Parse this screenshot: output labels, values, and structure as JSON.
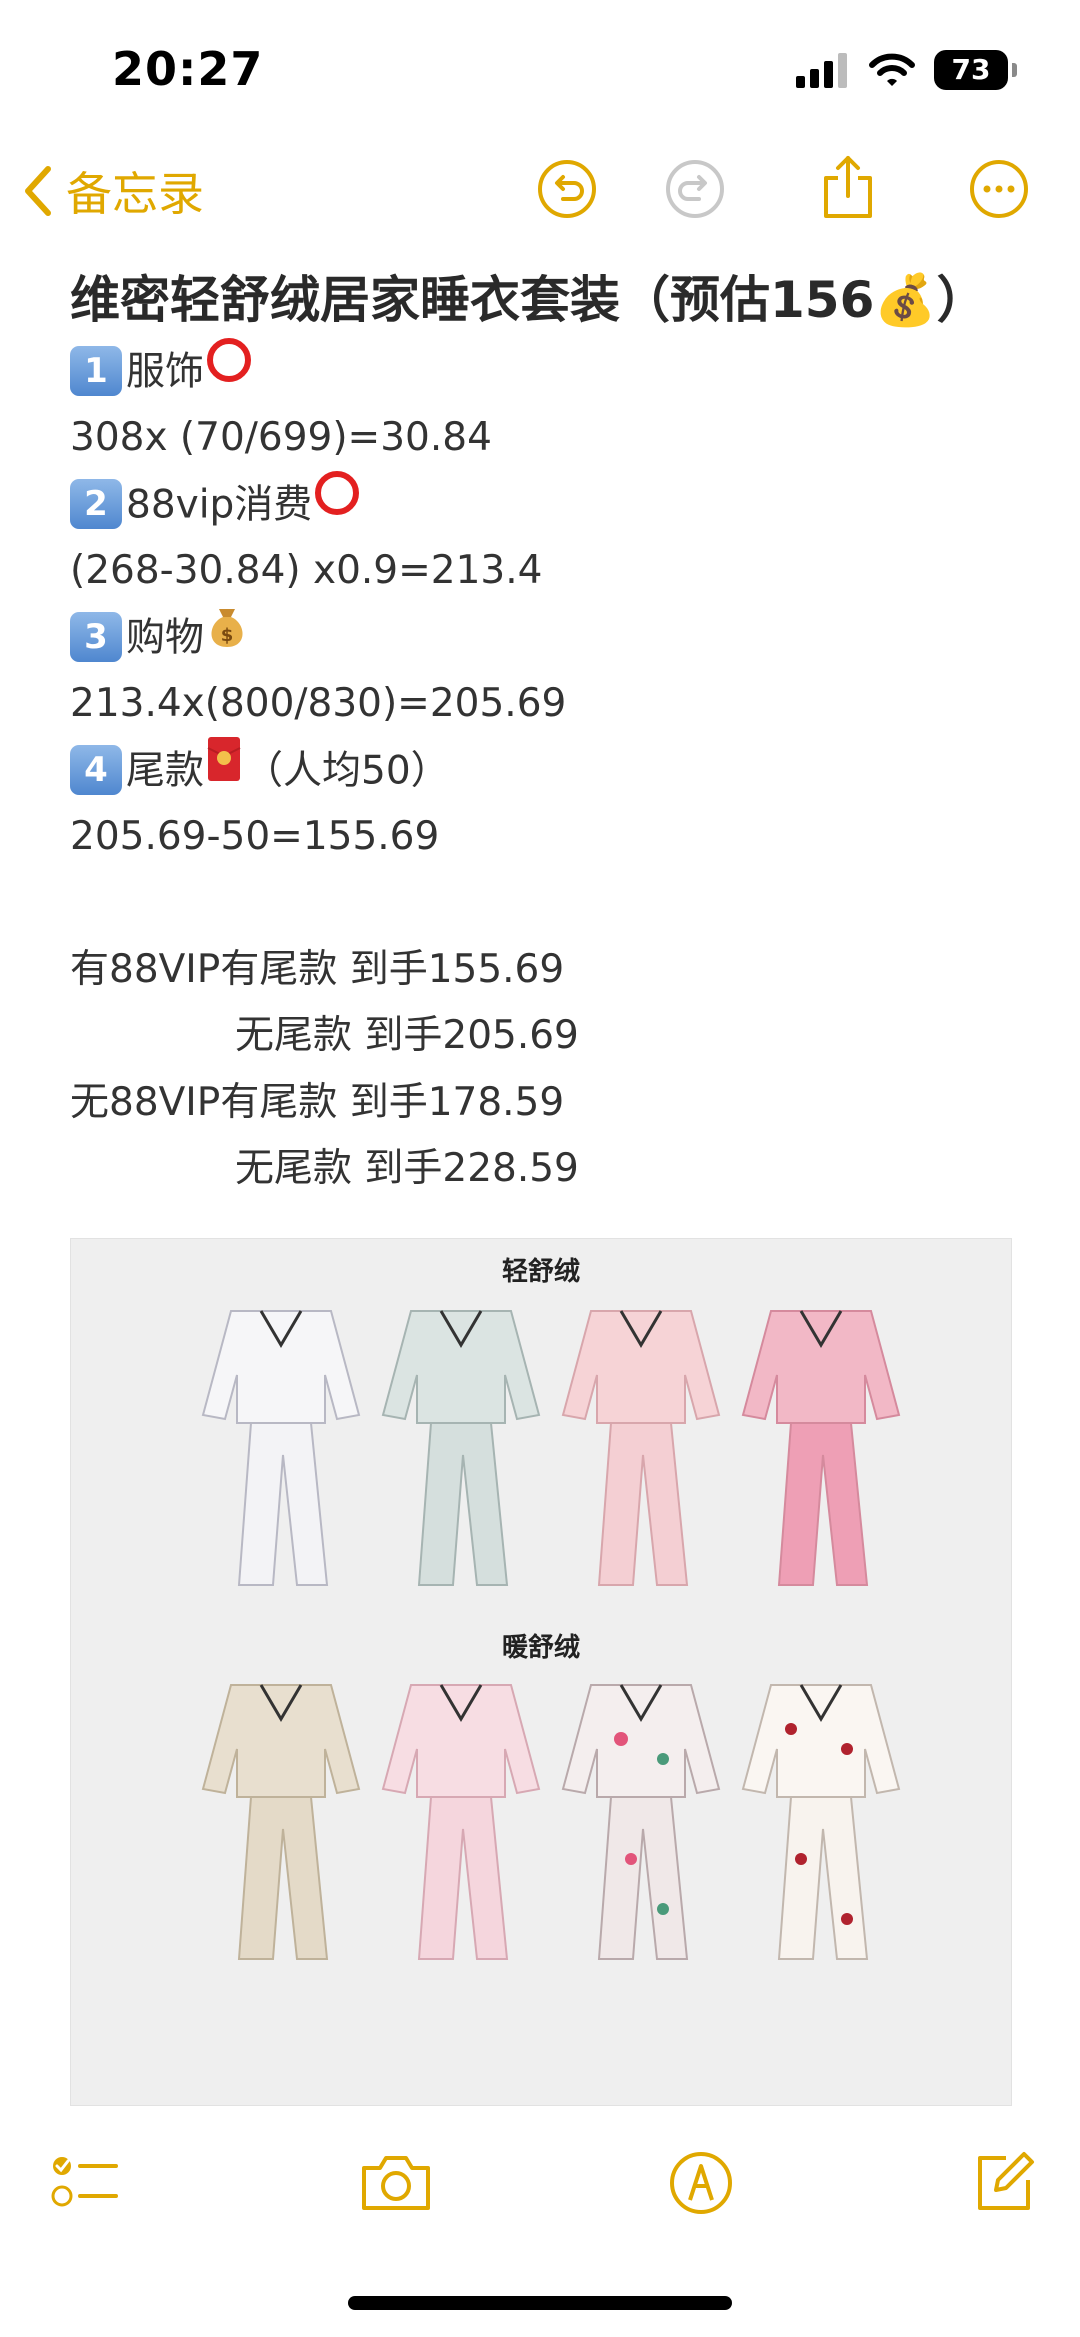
{
  "status": {
    "time": "20:27",
    "battery": "73"
  },
  "nav": {
    "back_label": "备忘录"
  },
  "note": {
    "title": "维密轻舒绒居家睡衣套装（预估156💰）",
    "lines": {
      "l1_label": "服饰",
      "l1_formula": "308x (70/699)=30.84",
      "l2_label": "88vip消费",
      "l2_formula": "(268-30.84) x0.9=213.4",
      "l3_label": "购物",
      "l3_formula": "213.4x(800/830)=205.69",
      "l4_label": "尾款",
      "l4_suffix": "（人均50）",
      "l4_formula": "205.69-50=155.69",
      "s1": "有88VIP有尾款 到手155.69",
      "s2": "无尾款 到手205.69",
      "s3": "无88VIP有尾款 到手178.59",
      "s4": "无尾款 到手228.59"
    },
    "numbers": {
      "n1": "1",
      "n2": "2",
      "n3": "3",
      "n4": "4"
    }
  },
  "image": {
    "section1": "轻舒绒",
    "section2": "暖舒绒"
  },
  "colors": {
    "accent": "#e0a800",
    "accent_gray": "#c8c8c8"
  },
  "icons": [
    "chevron-left-icon",
    "undo-icon",
    "redo-icon",
    "share-icon",
    "more-icon",
    "checklist-icon",
    "camera-icon",
    "markup-icon",
    "compose-icon"
  ]
}
